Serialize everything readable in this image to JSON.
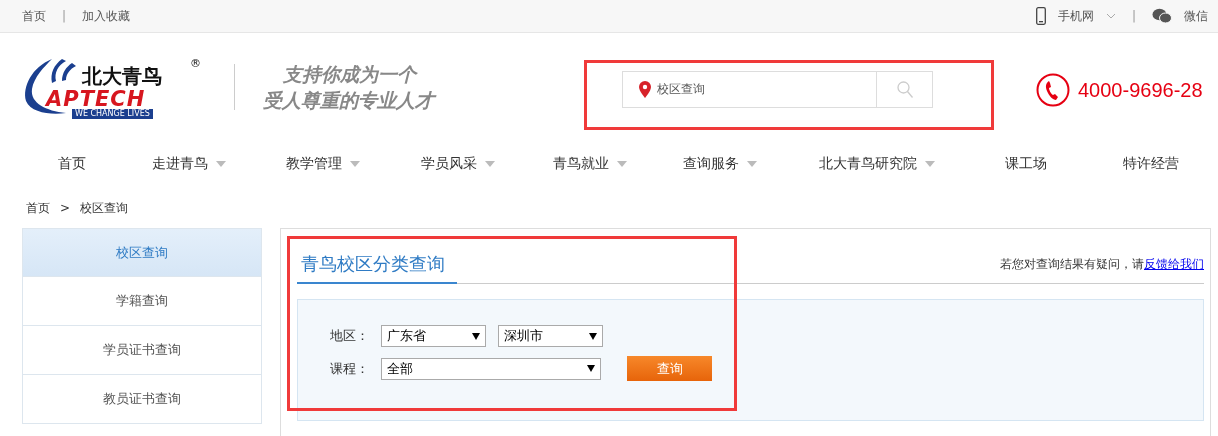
{
  "top_bar": {
    "links": [
      "首页",
      "加入收藏"
    ],
    "separator": "|",
    "right": [
      {
        "kind": "mobile",
        "label": "手机网"
      },
      {
        "kind": "wechat",
        "label": "微信"
      }
    ],
    "right_separator": "|"
  },
  "header": {
    "logo": {
      "name": "北大青鸟",
      "brand": "APTECH",
      "tagline": "WE CHANGE LIVES",
      "mark": "®"
    },
    "slogan": [
      "支持你成为一个",
      "受人尊重的专业人才"
    ],
    "search": {
      "value": "校区查询"
    },
    "hotline": "4000-9696-28"
  },
  "nav": [
    {
      "label": "首页",
      "dropdown": false
    },
    {
      "label": "走进青鸟",
      "dropdown": true
    },
    {
      "label": "教学管理",
      "dropdown": true
    },
    {
      "label": "学员风采",
      "dropdown": true
    },
    {
      "label": "青鸟就业",
      "dropdown": true
    },
    {
      "label": "查询服务",
      "dropdown": true
    },
    {
      "label": "北大青鸟研究院",
      "dropdown": true
    },
    {
      "label": "课工场",
      "dropdown": false
    },
    {
      "label": "特许经营",
      "dropdown": false
    }
  ],
  "breadcrumb": {
    "items": [
      "首页",
      "校区查询"
    ],
    "separator": ">"
  },
  "sidebar": {
    "items": [
      {
        "label": "校区查询",
        "selected": true
      },
      {
        "label": "学籍查询",
        "selected": false
      },
      {
        "label": "学员证书查询",
        "selected": false
      },
      {
        "label": "教员证书查询",
        "selected": false
      }
    ]
  },
  "main": {
    "title": "青鸟校区分类查询",
    "notice": "若您对查询结果有疑问，请",
    "notice_link": "反馈给我们",
    "form": {
      "region_label": "地区：",
      "province": "广东省",
      "city": "深圳市",
      "course_label": "课程：",
      "course": "全部",
      "submit": "查询"
    }
  }
}
